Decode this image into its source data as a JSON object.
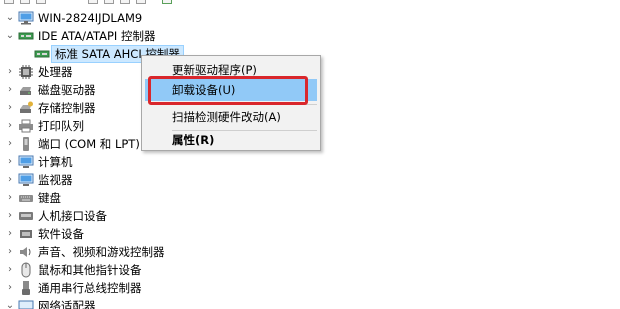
{
  "tree": {
    "root": {
      "label": "WIN-2824IJDLAM9",
      "icon": "computer-root-icon"
    },
    "ide": {
      "label": "IDE ATA/ATAPI 控制器",
      "icon": "ide-controller-icon",
      "expanded": true,
      "child": {
        "label": "标准 SATA AHCI 控制器",
        "icon": "ide-device-icon",
        "selected": true
      }
    },
    "categories": [
      {
        "label": "处理器",
        "icon": "processor-icon"
      },
      {
        "label": "磁盘驱动器",
        "icon": "disk-drive-icon"
      },
      {
        "label": "存储控制器",
        "icon": "storage-controller-icon"
      },
      {
        "label": "打印队列",
        "icon": "printer-icon"
      },
      {
        "label": "端口 (COM 和 LPT)",
        "icon": "port-icon"
      },
      {
        "label": "计算机",
        "icon": "monitor-icon"
      },
      {
        "label": "监视器",
        "icon": "monitor-icon"
      },
      {
        "label": "键盘",
        "icon": "keyboard-icon"
      },
      {
        "label": "人机接口设备",
        "icon": "hid-icon"
      },
      {
        "label": "软件设备",
        "icon": "software-device-icon"
      },
      {
        "label": "声音、视频和游戏控制器",
        "icon": "speaker-icon"
      },
      {
        "label": "鼠标和其他指针设备",
        "icon": "mouse-icon"
      },
      {
        "label": "通用串行总线控制器",
        "icon": "usb-icon"
      },
      {
        "label": "网络适配器",
        "icon": "network-adapter-icon"
      }
    ]
  },
  "context_menu": {
    "items": [
      {
        "label": "更新驱动程序(P)",
        "highlighted": false,
        "bold": false
      },
      {
        "label": "卸载设备(U)",
        "highlighted": true,
        "bold": false
      },
      {
        "label": "扫描检测硬件改动(A)",
        "highlighted": false,
        "bold": false
      },
      {
        "label": "属性(R)",
        "highlighted": false,
        "bold": true
      }
    ]
  },
  "colors": {
    "selection_bg": "#cce8ff",
    "menu_highlight": "#91c9f7",
    "annotation_red": "#d9272c",
    "menu_bg": "#f2f2f2"
  }
}
